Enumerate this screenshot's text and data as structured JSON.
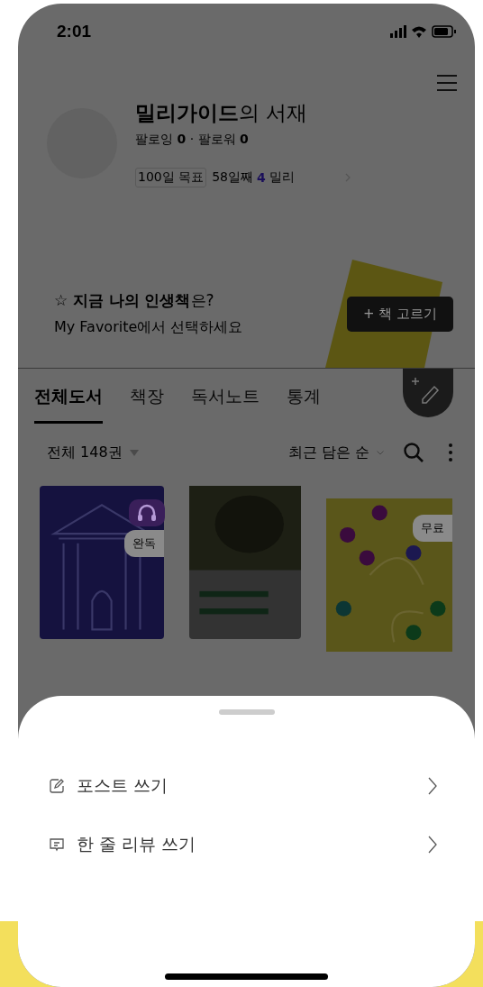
{
  "status_bar": {
    "time": "2:01"
  },
  "profile": {
    "title": "**밀리가이드**의 서재",
    "follow": "팔로잉 **0** · 팔로워 **0**",
    "goal_label": "100일 목표",
    "goal_day": "58일째",
    "goal_count": "4",
    "goal_unit": "밀리"
  },
  "favorite": {
    "title": "☆ **지금 나의 인생책**은?",
    "subtitle": "My Favorite에서 선택하세요",
    "button": "+ 책 고르기"
  },
  "tabs": [
    {
      "label": "전체도서",
      "selected": true
    },
    {
      "label": "책장",
      "selected": false
    },
    {
      "label": "독서노트",
      "selected": false
    },
    {
      "label": "통계",
      "selected": false
    }
  ],
  "filter": {
    "count": "전체 148권",
    "sort": "최근 담은 순"
  },
  "books": [
    {
      "kind": "temple",
      "audio": true,
      "badge": "완독"
    },
    {
      "kind": "forest",
      "audio": false
    },
    {
      "kind": "dots",
      "audio": false,
      "badge": "무료"
    }
  ],
  "sheet": {
    "items": [
      {
        "kind": "post",
        "label": "포스트 쓰기"
      },
      {
        "kind": "review",
        "label": "한 줄 리뷰 쓰기"
      }
    ]
  }
}
